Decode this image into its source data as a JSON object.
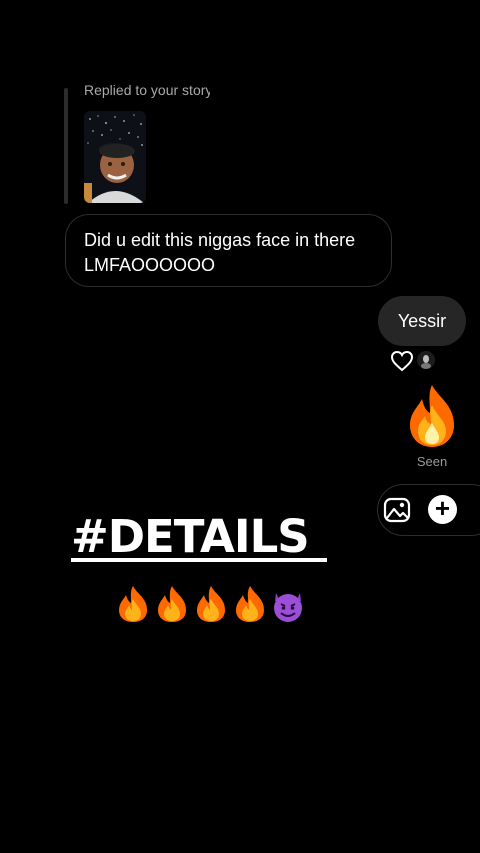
{
  "thread": {
    "reply_caption": "Replied to your story",
    "incoming_message": "Did u edit this niggas face in there LMFAOOOOOO",
    "outgoing_message": "Yessir",
    "big_emoji": "fire",
    "status": "Seen"
  },
  "composer": {
    "gallery_icon": "image-icon",
    "add_icon": "plus-icon",
    "add_label": "+"
  },
  "overlay": {
    "headline": "#DETAILS",
    "emojis": [
      "fire",
      "fire",
      "fire",
      "fire",
      "smiling-imp"
    ]
  },
  "colors": {
    "background": "#000000",
    "outgoing_bubble": "#262626",
    "incoming_border": "#2d2d2d",
    "caption": "#a8a8a8"
  }
}
